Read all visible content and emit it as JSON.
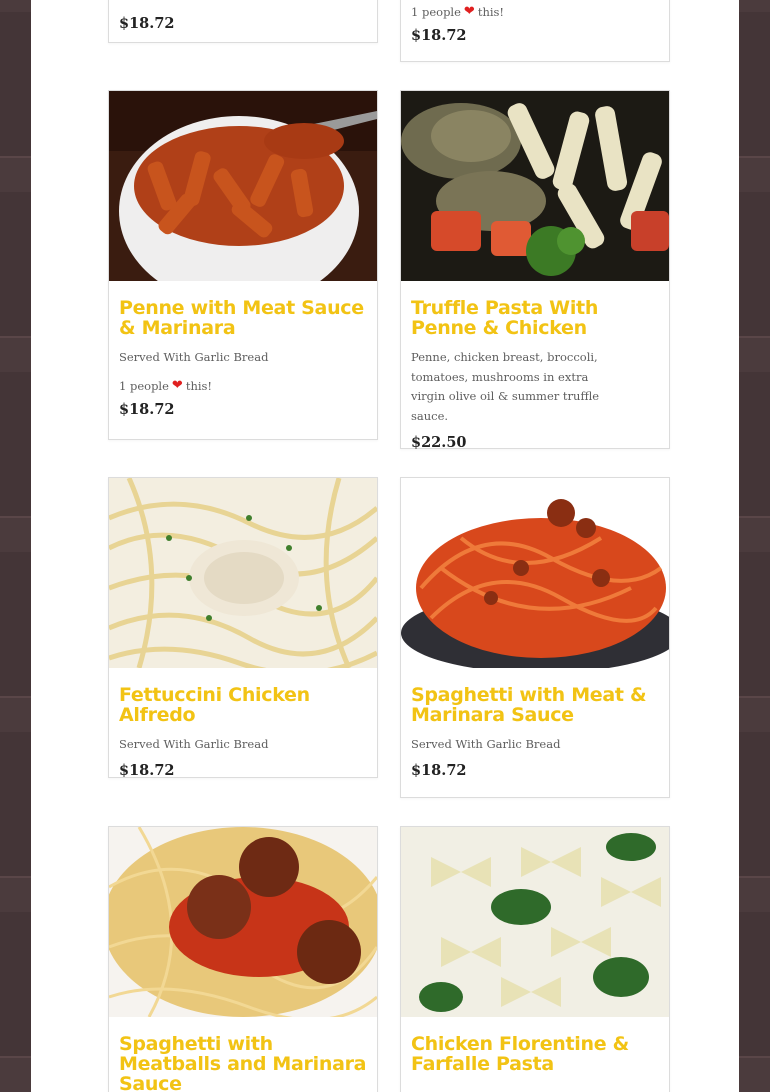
{
  "items": [
    {
      "title": "",
      "description": "",
      "likes_count": "",
      "likes_suffix": "",
      "price": "$18.72"
    },
    {
      "title": "",
      "description": "",
      "likes_count": "1 people",
      "likes_suffix": "this!",
      "price": "$18.72"
    },
    {
      "title": "Penne with Meat Sauce & Marinara",
      "description": "Served With Garlic Bread",
      "likes_count": "1 people",
      "likes_suffix": "this!",
      "price": "$18.72"
    },
    {
      "title": "Truffle Pasta With Penne & Chicken",
      "description": "Penne, chicken breast, broccoli, tomatoes, mushrooms in extra virgin olive oil & summer truffle sauce.",
      "likes_count": "",
      "likes_suffix": "",
      "price": "$22.50"
    },
    {
      "title": "Fettuccini Chicken Alfredo",
      "description": "Served With Garlic Bread",
      "likes_count": "",
      "likes_suffix": "",
      "price": "$18.72"
    },
    {
      "title": "Spaghetti with Meat & Marinara Sauce",
      "description": "Served With Garlic Bread",
      "likes_count": "",
      "likes_suffix": "",
      "price": "$18.72"
    },
    {
      "title": "Spaghetti with Meatballs and Marinara Sauce",
      "description": "",
      "likes_count": "",
      "likes_suffix": "",
      "price": ""
    },
    {
      "title": "Chicken Florentine & Farfalle Pasta",
      "description": "",
      "likes_count": "",
      "likes_suffix": "",
      "price": ""
    }
  ],
  "icons": {
    "like": "heart-icon"
  },
  "colors": {
    "title": "#f2c314",
    "heart": "#e02020",
    "price": "#222222"
  }
}
